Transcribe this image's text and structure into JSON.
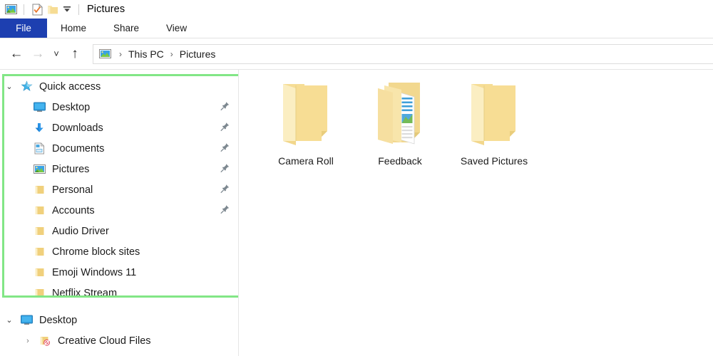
{
  "window": {
    "title": "Pictures",
    "quick_access_toolbar": [
      {
        "name": "pictures-library-icon",
        "label": "Pictures library"
      },
      {
        "name": "properties-icon",
        "label": "Properties"
      },
      {
        "name": "new-folder-icon",
        "label": "New folder"
      },
      {
        "name": "customize-qat-dropdown-icon",
        "label": "Customize Quick Access Toolbar"
      }
    ]
  },
  "ribbon": {
    "file_tab": "File",
    "tabs": [
      "Home",
      "Share",
      "View"
    ],
    "file_tab_color": "#1d3fb0"
  },
  "navbar": {
    "back": "←",
    "forward": "→",
    "recent": "˅",
    "up": "↑",
    "breadcrumb": [
      "This PC",
      "Pictures"
    ],
    "separator": "›"
  },
  "sidebar": {
    "highlight_color": "#82e686",
    "groups": [
      {
        "name": "Quick access",
        "icon": "star-icon",
        "expanded": true,
        "items": [
          {
            "label": "Desktop",
            "icon": "desktop-monitor-icon",
            "pinned": true
          },
          {
            "label": "Downloads",
            "icon": "download-arrow-icon",
            "pinned": true
          },
          {
            "label": "Documents",
            "icon": "documents-icon",
            "pinned": true
          },
          {
            "label": "Pictures",
            "icon": "pictures-icon",
            "pinned": true
          },
          {
            "label": "Personal",
            "icon": "folder-icon",
            "pinned": true
          },
          {
            "label": "Accounts",
            "icon": "folder-icon",
            "pinned": true
          },
          {
            "label": "Audio Driver",
            "icon": "folder-icon",
            "pinned": false
          },
          {
            "label": "Chrome block sites",
            "icon": "folder-icon",
            "pinned": false
          },
          {
            "label": "Emoji Windows 11",
            "icon": "folder-icon",
            "pinned": false
          },
          {
            "label": "Netflix Stream",
            "icon": "folder-icon",
            "pinned": false
          }
        ]
      },
      {
        "name": "Desktop",
        "icon": "desktop-monitor-icon",
        "expanded": true,
        "items": [
          {
            "label": "Creative Cloud Files",
            "icon": "creative-cloud-folder-icon",
            "pinned": false,
            "expandable": true
          }
        ]
      }
    ]
  },
  "content": {
    "items": [
      {
        "name": "Camera Roll",
        "icon": "folder-closed-icon"
      },
      {
        "name": "Feedback",
        "icon": "folder-open-with-files-icon"
      },
      {
        "name": "Saved Pictures",
        "icon": "folder-closed-icon"
      }
    ]
  }
}
